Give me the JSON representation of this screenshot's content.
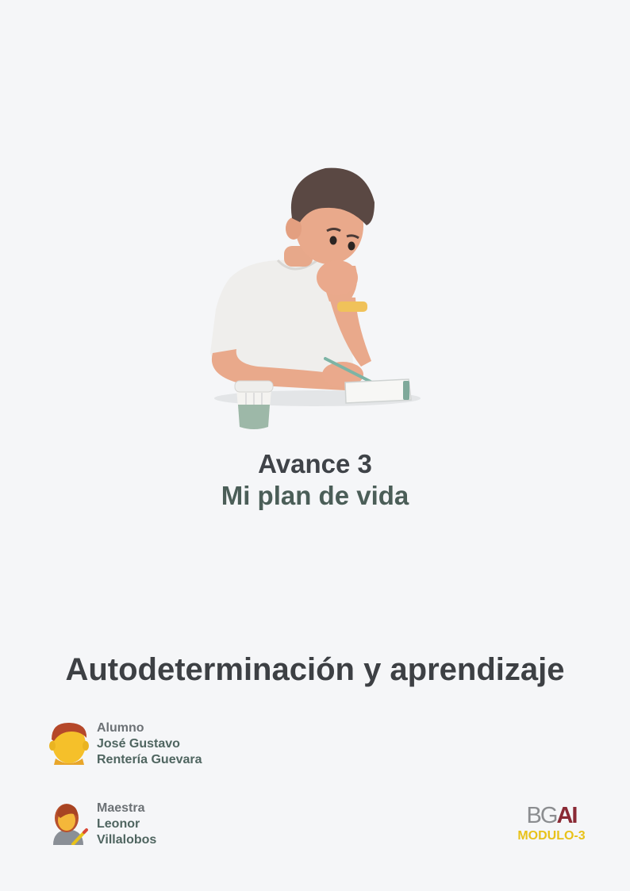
{
  "cover": {
    "avance": "Avance 3",
    "plan": "Mi plan de vida",
    "subject": "Autodeterminación y aprendizaje"
  },
  "student": {
    "role": "Alumno",
    "name_line1": "José Gustavo",
    "name_line2": "Rentería Guevara",
    "icon": "student-face-icon"
  },
  "teacher": {
    "role": "Maestra",
    "name_line1": "Leonor",
    "name_line2": "Villalobos",
    "icon": "teacher-icon"
  },
  "logo": {
    "mark_left": "BG",
    "mark_right": "AI",
    "module": "MODULO-3"
  },
  "colors": {
    "background": "#f5f6f8",
    "title_dark": "#3f4348",
    "title_green": "#4b5e58",
    "module_yellow": "#e8c21a",
    "logo_red": "#8a2a35"
  }
}
